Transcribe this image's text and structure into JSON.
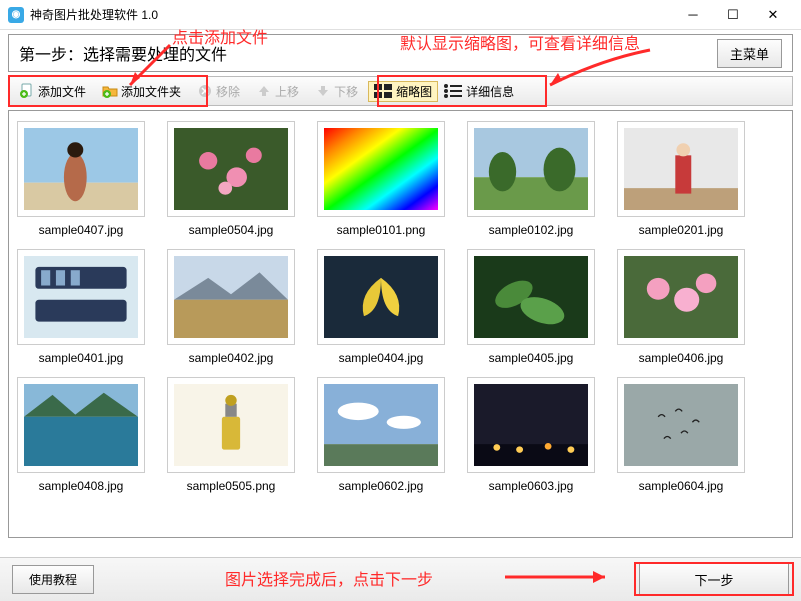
{
  "title": "神奇图片批处理软件 1.0",
  "step_header": "第一步：选择需要处理的文件",
  "main_menu": "主菜单",
  "toolbar": {
    "add_file": "添加文件",
    "add_folder": "添加文件夹",
    "remove": "移除",
    "move_up": "上移",
    "move_down": "下移",
    "thumb_view": "缩略图",
    "detail_view": "详细信息"
  },
  "files": [
    {
      "name": "sample0407.jpg",
      "thumb": "woman-beach"
    },
    {
      "name": "sample0504.jpg",
      "thumb": "pink-flowers"
    },
    {
      "name": "sample0101.png",
      "thumb": "rainbow"
    },
    {
      "name": "sample0102.jpg",
      "thumb": "park-trees"
    },
    {
      "name": "sample0201.jpg",
      "thumb": "woman-fence"
    },
    {
      "name": "sample0401.jpg",
      "thumb": "film-strip"
    },
    {
      "name": "sample0402.jpg",
      "thumb": "mountain-plain"
    },
    {
      "name": "sample0404.jpg",
      "thumb": "ginkgo"
    },
    {
      "name": "sample0405.jpg",
      "thumb": "green-leaves"
    },
    {
      "name": "sample0406.jpg",
      "thumb": "sakura"
    },
    {
      "name": "sample0408.jpg",
      "thumb": "lake-mountains"
    },
    {
      "name": "sample0505.png",
      "thumb": "perfume"
    },
    {
      "name": "sample0602.jpg",
      "thumb": "sky-photo"
    },
    {
      "name": "sample0603.jpg",
      "thumb": "night-city"
    },
    {
      "name": "sample0604.jpg",
      "thumb": "birds-sky"
    }
  ],
  "footer": {
    "tutorial": "使用教程",
    "next": "下一步"
  },
  "annotations": {
    "click_add_file": "点击添加文件",
    "default_thumb_view": "默认显示缩略图，可查看详细信息",
    "after_select": "图片选择完成后，点击下一步"
  }
}
